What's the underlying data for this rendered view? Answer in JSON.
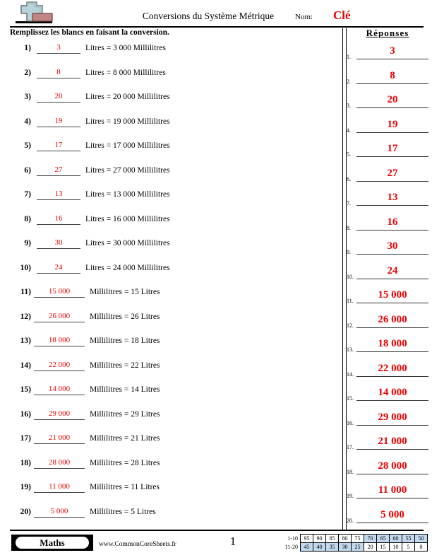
{
  "header": {
    "title": "Conversions du Système Métrique",
    "name_label": "Nom:",
    "name_value": "Clé",
    "logo_icon": "plus-block-logo"
  },
  "instruction": "Remplissez les blancs en faisant la conversion.",
  "answers_title": "Réponses",
  "problems": [
    {
      "num": "1)",
      "blank": "3",
      "text": "Litres = 3 000 Millilitres"
    },
    {
      "num": "2)",
      "blank": "8",
      "text": "Litres = 8 000 Millilitres"
    },
    {
      "num": "3)",
      "blank": "20",
      "text": "Litres = 20 000 Millilitres"
    },
    {
      "num": "4)",
      "blank": "19",
      "text": "Litres = 19 000 Millilitres"
    },
    {
      "num": "5)",
      "blank": "17",
      "text": "Litres = 17 000 Millilitres"
    },
    {
      "num": "6)",
      "blank": "27",
      "text": "Litres = 27 000 Millilitres"
    },
    {
      "num": "7)",
      "blank": "13",
      "text": "Litres = 13 000 Millilitres"
    },
    {
      "num": "8)",
      "blank": "16",
      "text": "Litres = 16 000 Millilitres"
    },
    {
      "num": "9)",
      "blank": "30",
      "text": "Litres = 30 000 Millilitres"
    },
    {
      "num": "10)",
      "blank": "24",
      "text": "Litres = 24 000 Millilitres"
    },
    {
      "num": "11)",
      "blank": "15 000",
      "text": "Millilitres = 15 Litres"
    },
    {
      "num": "12)",
      "blank": "26 000",
      "text": "Millilitres = 26 Litres"
    },
    {
      "num": "13)",
      "blank": "18 000",
      "text": "Millilitres = 18 Litres"
    },
    {
      "num": "14)",
      "blank": "22 000",
      "text": "Millilitres = 22 Litres"
    },
    {
      "num": "15)",
      "blank": "14 000",
      "text": "Millilitres = 14 Litres"
    },
    {
      "num": "16)",
      "blank": "29 000",
      "text": "Millilitres = 29 Litres"
    },
    {
      "num": "17)",
      "blank": "21 000",
      "text": "Millilitres = 21 Litres"
    },
    {
      "num": "18)",
      "blank": "28 000",
      "text": "Millilitres = 28 Litres"
    },
    {
      "num": "19)",
      "blank": "11 000",
      "text": "Millilitres = 11 Litres"
    },
    {
      "num": "20)",
      "blank": "5 000",
      "text": "Millilitres = 5 Litres"
    }
  ],
  "answers": [
    {
      "num": "1.",
      "value": "3"
    },
    {
      "num": "2.",
      "value": "8"
    },
    {
      "num": "3.",
      "value": "20"
    },
    {
      "num": "4.",
      "value": "19"
    },
    {
      "num": "5.",
      "value": "17"
    },
    {
      "num": "6.",
      "value": "27"
    },
    {
      "num": "7.",
      "value": "13"
    },
    {
      "num": "8.",
      "value": "16"
    },
    {
      "num": "9.",
      "value": "30"
    },
    {
      "num": "10.",
      "value": "24"
    },
    {
      "num": "11.",
      "value": "15 000"
    },
    {
      "num": "12.",
      "value": "26 000"
    },
    {
      "num": "13.",
      "value": "18 000"
    },
    {
      "num": "14.",
      "value": "22 000"
    },
    {
      "num": "15.",
      "value": "14 000"
    },
    {
      "num": "16.",
      "value": "29 000"
    },
    {
      "num": "17.",
      "value": "21 000"
    },
    {
      "num": "18.",
      "value": "28 000"
    },
    {
      "num": "19.",
      "value": "11 000"
    },
    {
      "num": "20.",
      "value": "5 000"
    }
  ],
  "footer": {
    "subject": "Maths",
    "url": "www.CommonCoreSheets.fr",
    "page": "1"
  },
  "score_grid": {
    "row1_label": "1-10",
    "row2_label": "11-20",
    "row1": [
      {
        "v": "95",
        "hl": false
      },
      {
        "v": "90",
        "hl": false
      },
      {
        "v": "85",
        "hl": false
      },
      {
        "v": "80",
        "hl": false
      },
      {
        "v": "75",
        "hl": false
      },
      {
        "v": "70",
        "hl": true
      },
      {
        "v": "65",
        "hl": true
      },
      {
        "v": "60",
        "hl": true
      },
      {
        "v": "55",
        "hl": true
      },
      {
        "v": "50",
        "hl": true
      }
    ],
    "row2": [
      {
        "v": "45",
        "hl": true
      },
      {
        "v": "40",
        "hl": true
      },
      {
        "v": "35",
        "hl": true
      },
      {
        "v": "30",
        "hl": true
      },
      {
        "v": "25",
        "hl": true
      },
      {
        "v": "20",
        "hl": false
      },
      {
        "v": "15",
        "hl": false
      },
      {
        "v": "10",
        "hl": false
      },
      {
        "v": "5",
        "hl": false
      },
      {
        "v": "0",
        "hl": false
      }
    ]
  },
  "colors": {
    "answer_red": "#ee0000",
    "highlight_blue": "#c3d9f0",
    "logo_cross": "#b8d4d8",
    "logo_block": "#c08585"
  }
}
